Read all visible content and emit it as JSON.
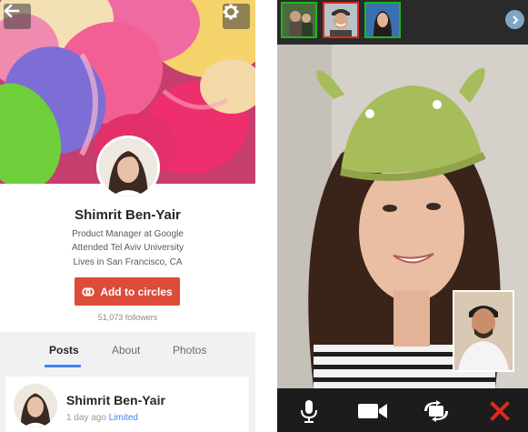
{
  "profile": {
    "name": "Shimrit Ben-Yair",
    "lines": [
      "Product Manager at Google",
      "Attended Tel Aviv University",
      "Lives in San Francisco, CA"
    ],
    "add_button_label": "Add to circles",
    "followers": "51,073 followers",
    "tabs": [
      {
        "label": "Posts",
        "active": true
      },
      {
        "label": "About",
        "active": false
      },
      {
        "label": "Photos",
        "active": false
      }
    ],
    "post": {
      "author": "Shimrit Ben-Yair",
      "time": "1 day ago",
      "visibility": "Limited"
    },
    "icons": {
      "back": "back-arrow-icon",
      "settings": "gear-icon",
      "circles": "circles-icon"
    }
  },
  "hangout": {
    "participants": [
      {
        "name": "participant-1",
        "highlight": "#1fb51f"
      },
      {
        "name": "participant-2",
        "highlight": "#e0291d"
      },
      {
        "name": "participant-3",
        "highlight": "#1fb51f"
      }
    ],
    "controls": [
      "microphone-icon",
      "video-camera-icon",
      "switch-camera-icon",
      "end-call-icon"
    ]
  },
  "colors": {
    "accent": "#dd4b39",
    "link": "#4285f4",
    "end_call": "#e0291d"
  }
}
